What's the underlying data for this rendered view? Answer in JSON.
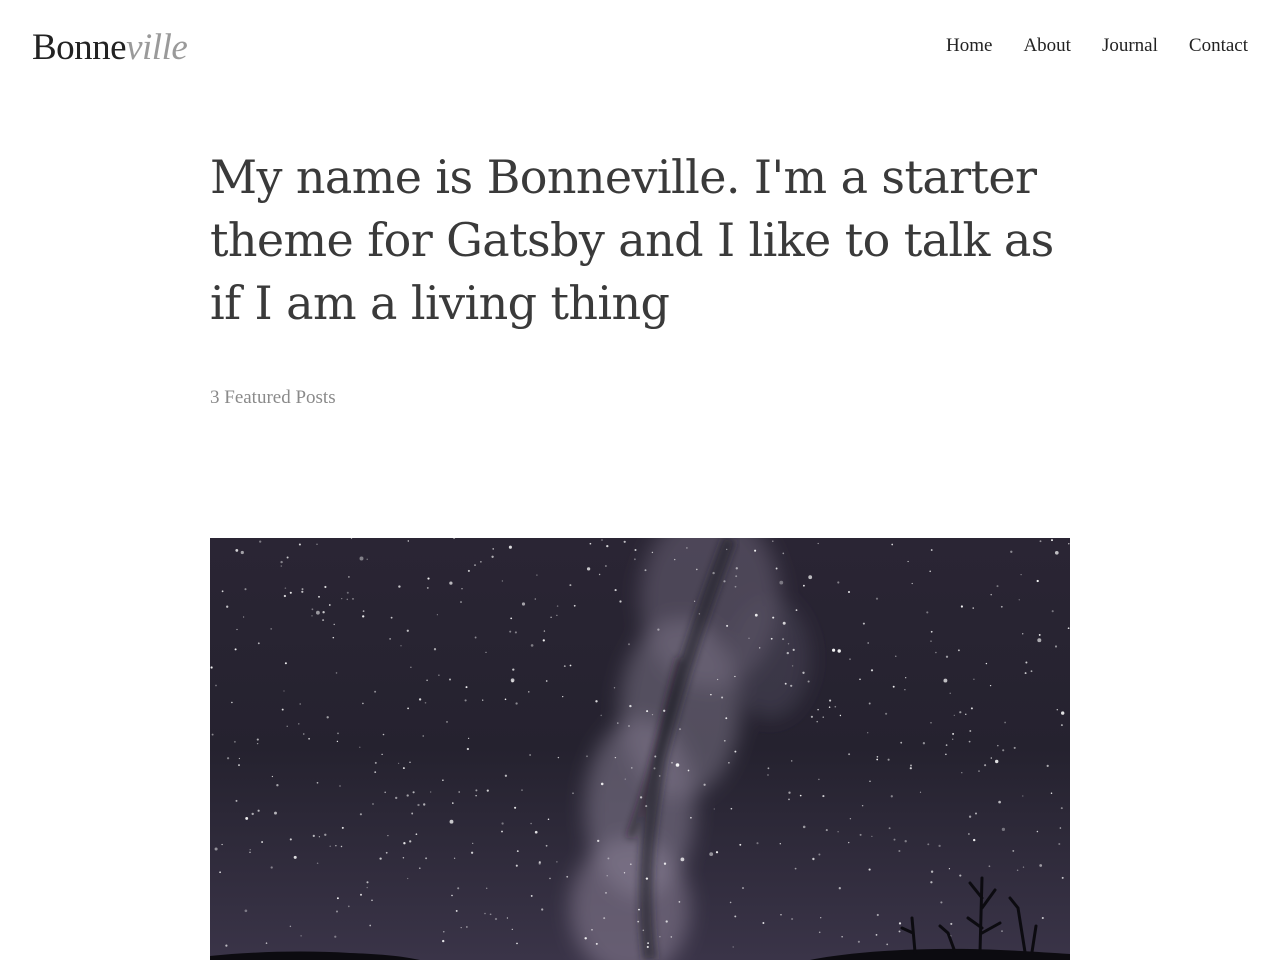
{
  "site": {
    "logo_main": "Bonne",
    "logo_accent": "ville"
  },
  "nav": {
    "items": [
      {
        "label": "Home"
      },
      {
        "label": "About"
      },
      {
        "label": "Journal"
      },
      {
        "label": "Contact"
      }
    ]
  },
  "intro": {
    "text": "My name is Bonneville. I'm a starter theme for Gatsby and I like to talk as if I am a living thing"
  },
  "featured": {
    "count_label": "3 Featured Posts"
  },
  "colors": {
    "text": "#333333",
    "muted": "#8a8a8a",
    "logo_accent": "#9a9a9a",
    "sky_dark": "#1f1c2c"
  }
}
